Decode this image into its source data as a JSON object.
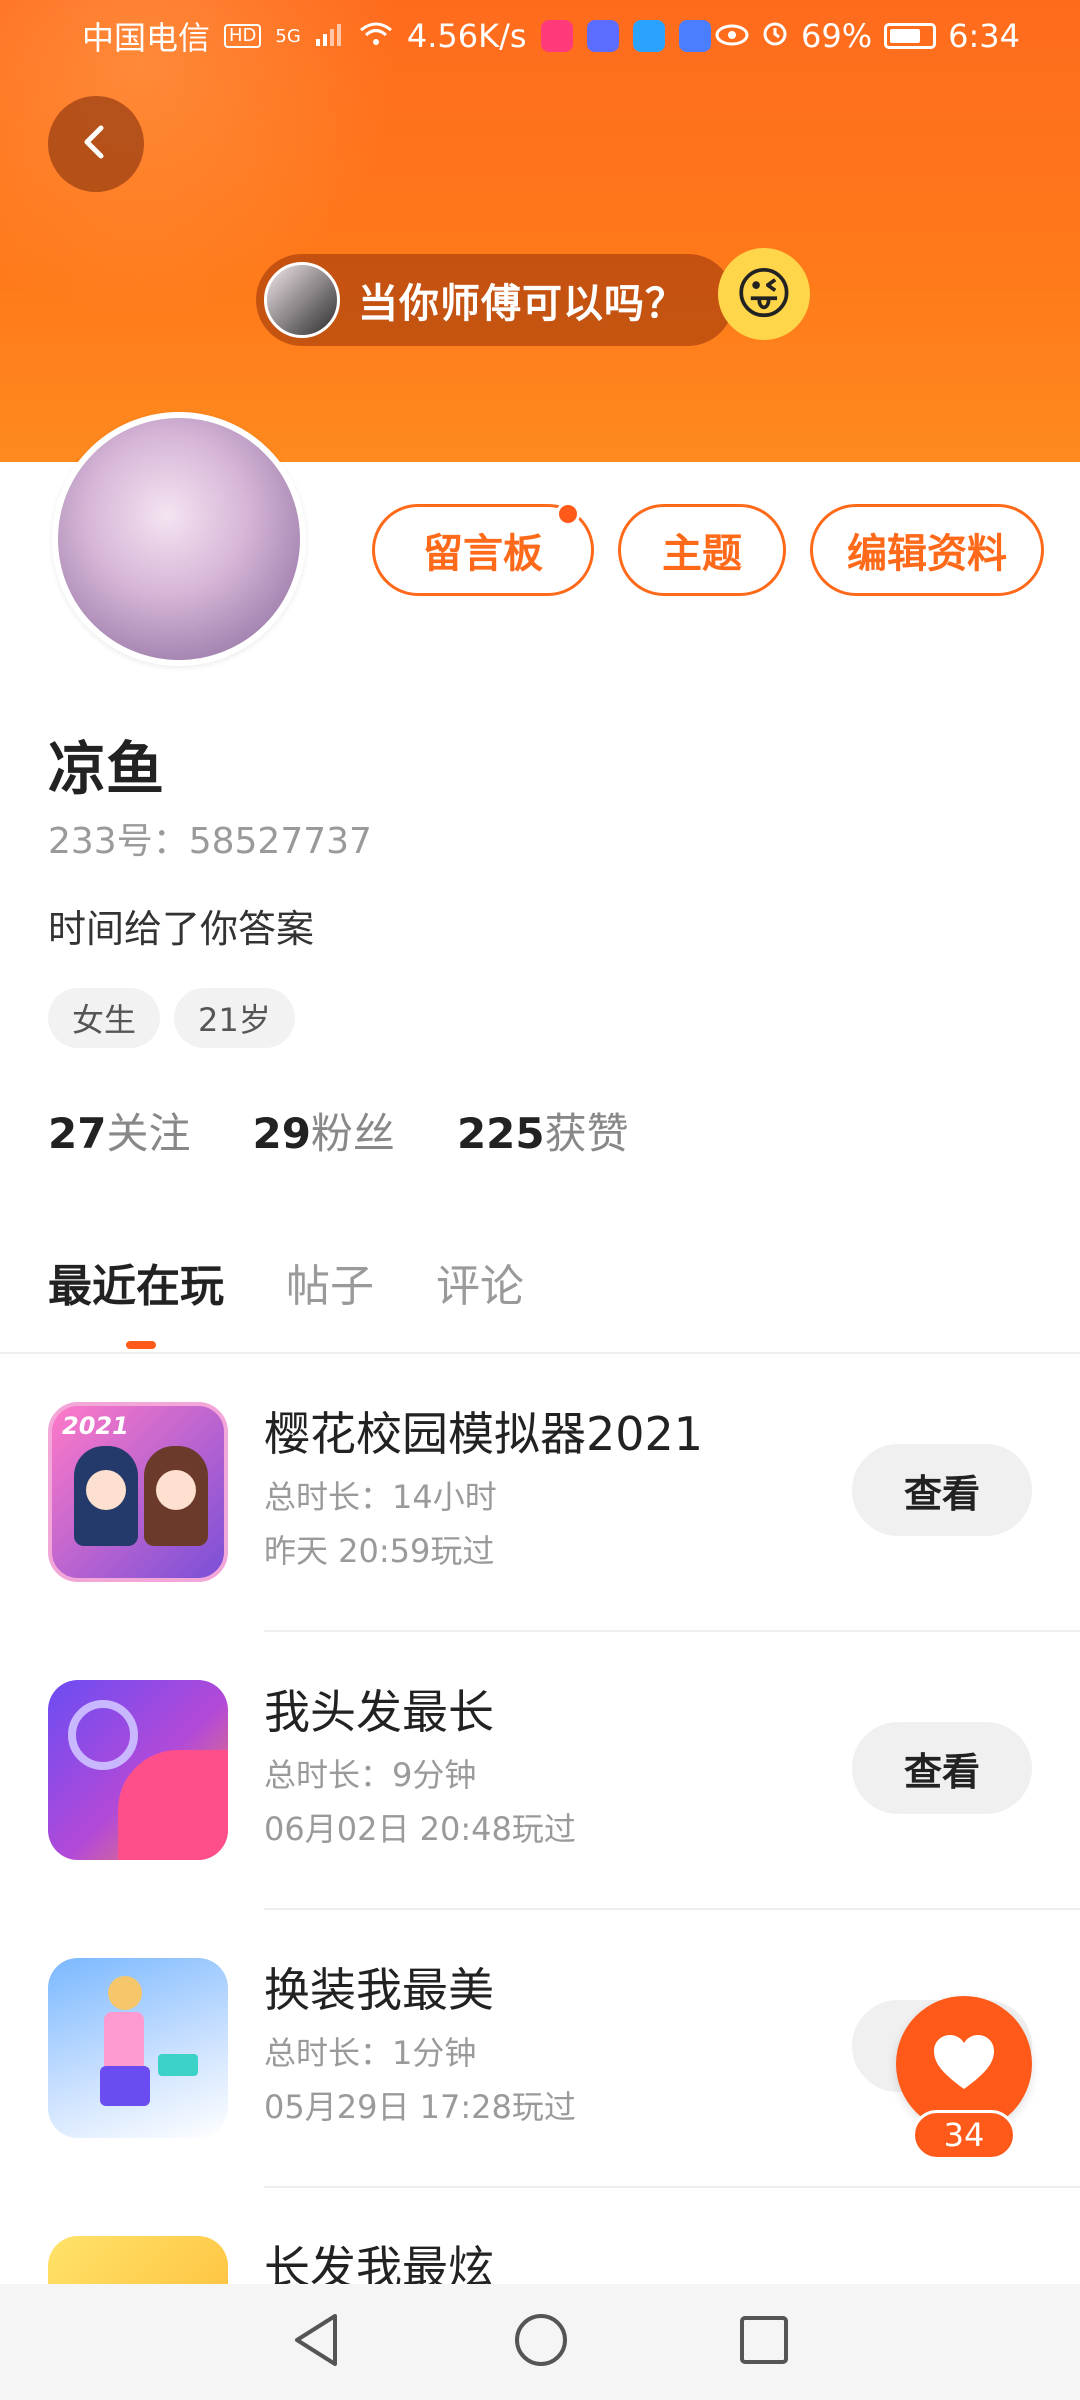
{
  "status_bar": {
    "carrier": "中国电信",
    "hd": "HD",
    "net": "5G",
    "speed": "4.56K/s",
    "battery": "69%",
    "time": "6:34"
  },
  "header": {
    "promo_text": "当你师傅可以吗？"
  },
  "profile": {
    "buttons": {
      "message_board": "留言板",
      "theme": "主题",
      "edit_profile": "编辑资料"
    },
    "name": "凉鱼",
    "uid": "233号：58527737",
    "bio": "时间给了你答案",
    "tags": [
      "女生",
      "21岁"
    ],
    "stats": {
      "following_count": "27",
      "following_label": "关注",
      "fans_count": "29",
      "fans_label": "粉丝",
      "likes_count": "225",
      "likes_label": "获赞"
    }
  },
  "tabs": [
    {
      "label": "最近在玩"
    },
    {
      "label": "帖子"
    },
    {
      "label": "评论"
    }
  ],
  "games": [
    {
      "title": "樱花校园模拟器2021",
      "duration": "总时长：14小时",
      "last_played": "昨天 20:59玩过",
      "button": "查看",
      "icon_text": "2021"
    },
    {
      "title": "我头发最长",
      "duration": "总时长：9分钟",
      "last_played": "06月02日 20:48玩过",
      "button": "查看"
    },
    {
      "title": "换装我最美",
      "duration": "总时长：1分钟",
      "last_played": "05月29日 17:28玩过",
      "button": "查看"
    },
    {
      "title": "长发我最炫"
    }
  ],
  "fab": {
    "count": "34"
  },
  "colors": {
    "accent": "#ff6a1a",
    "header_top": "#ff6b1d",
    "header_bottom": "#ff8a1e"
  }
}
